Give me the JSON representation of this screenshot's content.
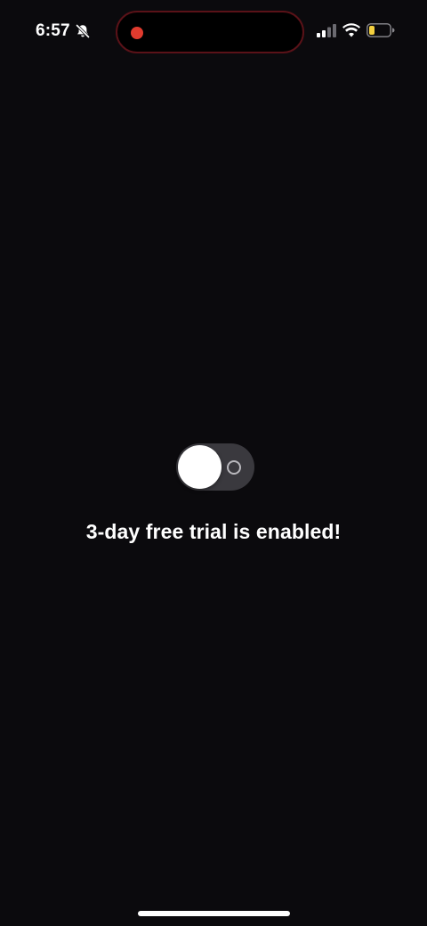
{
  "status_bar": {
    "time": "6:57",
    "mute_icon": "bell-slash-icon",
    "recording_indicator_color": "#e03b2e",
    "signal_icon": "cellular-signal-icon",
    "wifi_icon": "wifi-icon",
    "battery_icon": "battery-icon",
    "battery_level": 0.2,
    "battery_color": "#f4d03f"
  },
  "main": {
    "toggle_state": "off",
    "message": "3-day free trial is enabled!"
  },
  "colors": {
    "background": "#0b0a0d",
    "toggle_track": "#3a393e",
    "text": "#ffffff"
  }
}
